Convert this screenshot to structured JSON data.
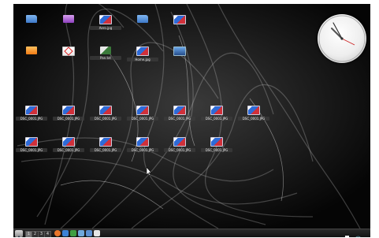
{
  "desktop": {
    "icons": [
      {
        "label": "",
        "type": "folder",
        "row": 0,
        "col": 0
      },
      {
        "label": "",
        "type": "folder-purple",
        "row": 0,
        "col": 1
      },
      {
        "label": "Aero.jpg",
        "type": "image",
        "row": 0,
        "col": 2
      },
      {
        "label": "",
        "type": "folder",
        "row": 0,
        "col": 3
      },
      {
        "label": "",
        "type": "image",
        "row": 0,
        "col": 4
      },
      {
        "label": "",
        "type": "folder-orange",
        "row": 1,
        "col": 0
      },
      {
        "label": "",
        "type": "pdf",
        "row": 1,
        "col": 1
      },
      {
        "label": "Pan.txt",
        "type": "python",
        "row": 1,
        "col": 2
      },
      {
        "label": "Home.jpg",
        "type": "image",
        "row": 1,
        "col": 3
      },
      {
        "label": "",
        "type": "screen",
        "row": 1,
        "col": 4
      },
      {
        "label": "DSC_0001.JPG",
        "type": "image",
        "row": 2,
        "col": 0
      },
      {
        "label": "DSC_0001.JPG",
        "type": "image",
        "row": 2,
        "col": 1
      },
      {
        "label": "DSC_0001.JPG",
        "type": "image",
        "row": 2,
        "col": 2
      },
      {
        "label": "DSC_0001.JPG",
        "type": "image",
        "row": 2,
        "col": 3
      },
      {
        "label": "DSC_0001.JPG",
        "type": "image",
        "row": 2,
        "col": 4
      },
      {
        "label": "DSC_0001.JPG",
        "type": "image",
        "row": 2,
        "col": 5
      },
      {
        "label": "DSC_0001.JPG",
        "type": "image",
        "row": 2,
        "col": 6
      },
      {
        "label": "DSC_0001.JPG",
        "type": "image",
        "row": 3,
        "col": 0
      },
      {
        "label": "DSC_0001.JPG",
        "type": "image",
        "row": 3,
        "col": 1
      },
      {
        "label": "DSC_0001.JPG",
        "type": "image",
        "row": 3,
        "col": 2
      },
      {
        "label": "DSC_0001.JPG",
        "type": "image",
        "row": 3,
        "col": 3
      },
      {
        "label": "DSC_0001.JPG",
        "type": "image",
        "row": 3,
        "col": 4
      },
      {
        "label": "DSC_0001.JPG",
        "type": "image",
        "row": 3,
        "col": 5
      }
    ]
  },
  "taskbar": {
    "pager": [
      "1",
      "2",
      "3",
      "4"
    ],
    "active_desktop": "1",
    "launchers": [
      "firefox-icon",
      "browser-icon",
      "chat-icon",
      "file-manager-icon",
      "folder-icon",
      "document-icon"
    ],
    "tray": [
      "printer-icon",
      "network-icon"
    ]
  },
  "colors": {
    "desktop_background": "#0b0b0b",
    "taskbar": "#1a1a1a"
  }
}
